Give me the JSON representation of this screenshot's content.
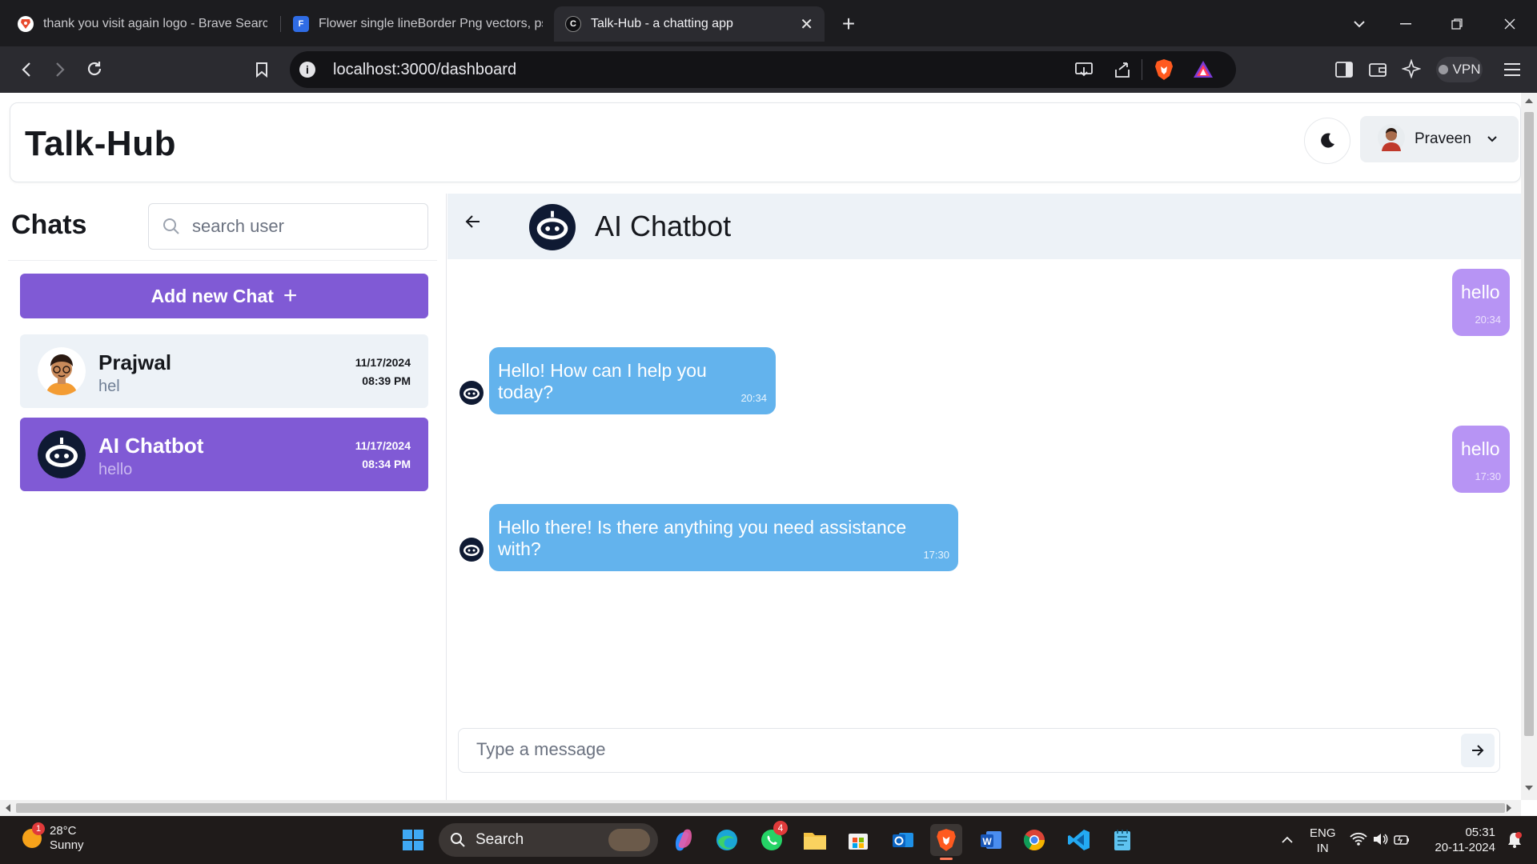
{
  "browser": {
    "tabs": [
      {
        "title": "thank you visit again logo - Brave Search",
        "active": false
      },
      {
        "title": "Flower single lineBorder Png vectors, psd",
        "active": false
      },
      {
        "title": "Talk-Hub - a chatting app",
        "active": true
      }
    ],
    "url": "localhost:3000/dashboard",
    "vpn_label": "VPN"
  },
  "app": {
    "title": "Talk-Hub",
    "user": {
      "name": "Praveen"
    }
  },
  "sidebar": {
    "title": "Chats",
    "search_placeholder": "search user",
    "add_chat_label": "Add new Chat",
    "chats": [
      {
        "name": "Prajwal",
        "preview": "hel",
        "date": "11/17/2024",
        "time": "08:39 PM",
        "active": false
      },
      {
        "name": "AI Chatbot",
        "preview": "hello",
        "date": "11/17/2024",
        "time": "08:34 PM",
        "active": true
      }
    ]
  },
  "conversation": {
    "name": "AI Chatbot",
    "messages": [
      {
        "from": "me",
        "text": "hello",
        "time": "20:34"
      },
      {
        "from": "bot",
        "text": "Hello! How can I help you today?",
        "time": "20:34"
      },
      {
        "from": "me",
        "text": "hello",
        "time": "17:30"
      },
      {
        "from": "bot",
        "text": "Hello there! Is there anything you need assistance with?",
        "time": "17:30"
      }
    ],
    "input_placeholder": "Type a message"
  },
  "taskbar": {
    "weather_temp": "28°C",
    "weather_desc": "Sunny",
    "weather_badge": "1",
    "search_label": "Search",
    "whatsapp_badge": "4",
    "lang_top": "ENG",
    "lang_bottom": "IN",
    "clock_time": "05:31",
    "clock_date": "20-11-2024"
  },
  "colors": {
    "accent": "#805ad5",
    "sent_bubble": "#b794f4",
    "received_bubble": "#63b3ed",
    "chat_header_bg": "#edf2f7"
  }
}
